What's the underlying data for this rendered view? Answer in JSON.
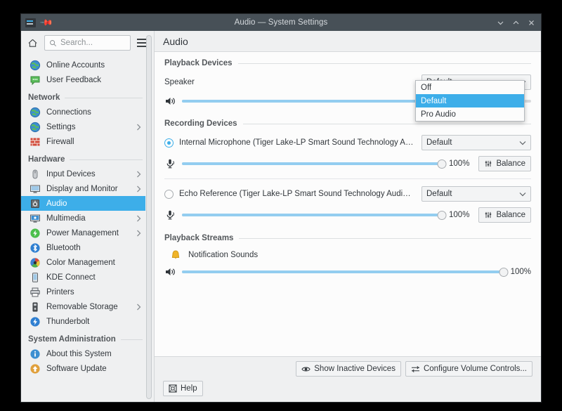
{
  "window": {
    "title": "Audio — System Settings",
    "app_icon": "system-settings-icon",
    "pin_icon": "keep-above-icon",
    "minimize_label": "Minimize",
    "maximize_label": "Maximize",
    "close_label": "Close"
  },
  "sidebar": {
    "home_icon": "home-icon",
    "menu_icon": "hamburger-menu-icon",
    "search": {
      "placeholder": "Search...",
      "value": ""
    },
    "groups": [
      {
        "title": null,
        "items": [
          {
            "label": "Online Accounts",
            "icon": "globe-icon",
            "chevron": false,
            "selected": false
          },
          {
            "label": "User Feedback",
            "icon": "feedback-icon",
            "chevron": false,
            "selected": false
          }
        ]
      },
      {
        "title": "Network",
        "items": [
          {
            "label": "Connections",
            "icon": "globe-icon",
            "chevron": false,
            "selected": false
          },
          {
            "label": "Settings",
            "icon": "globe-icon",
            "chevron": true,
            "selected": false
          },
          {
            "label": "Firewall",
            "icon": "firewall-icon",
            "chevron": false,
            "selected": false
          }
        ]
      },
      {
        "title": "Hardware",
        "items": [
          {
            "label": "Input Devices",
            "icon": "mouse-icon",
            "chevron": true,
            "selected": false
          },
          {
            "label": "Display and Monitor",
            "icon": "monitor-icon",
            "chevron": true,
            "selected": false
          },
          {
            "label": "Audio",
            "icon": "speaker-icon",
            "chevron": false,
            "selected": true
          },
          {
            "label": "Multimedia",
            "icon": "multimedia-icon",
            "chevron": true,
            "selected": false
          },
          {
            "label": "Power Management",
            "icon": "power-icon",
            "chevron": true,
            "selected": false
          },
          {
            "label": "Bluetooth",
            "icon": "bluetooth-icon",
            "chevron": false,
            "selected": false
          },
          {
            "label": "Color Management",
            "icon": "color-wheel-icon",
            "chevron": false,
            "selected": false
          },
          {
            "label": "KDE Connect",
            "icon": "phone-icon",
            "chevron": false,
            "selected": false
          },
          {
            "label": "Printers",
            "icon": "printer-icon",
            "chevron": false,
            "selected": false
          },
          {
            "label": "Removable Storage",
            "icon": "usb-drive-icon",
            "chevron": true,
            "selected": false
          },
          {
            "label": "Thunderbolt",
            "icon": "thunderbolt-icon",
            "chevron": false,
            "selected": false
          }
        ]
      },
      {
        "title": "System Administration",
        "items": [
          {
            "label": "About this System",
            "icon": "info-icon",
            "chevron": false,
            "selected": false
          },
          {
            "label": "Software Update",
            "icon": "update-icon",
            "chevron": false,
            "selected": false
          }
        ]
      }
    ]
  },
  "main": {
    "header_title": "Audio",
    "sections": {
      "playback_devices": {
        "title": "Playback Devices",
        "device": {
          "name": "Speaker",
          "port_value": "Default",
          "volume_percent": 72,
          "volume_icon": "volume-medium-icon"
        },
        "dropdown_open": true,
        "dropdown_options": [
          "Off",
          "Default",
          "Pro Audio"
        ],
        "dropdown_selected": "Default"
      },
      "recording_devices": {
        "title": "Recording Devices",
        "devices": [
          {
            "name": "Internal Microphone (Tiger Lake-LP Smart Sound Technology Audio Controlle...",
            "selected": true,
            "port_value": "Default",
            "volume_percent": 100,
            "volume_label": "100%",
            "volume_icon": "microphone-icon",
            "balance_label": "Balance",
            "balance_icon": "balance-sliders-icon"
          },
          {
            "name": "Echo Reference (Tiger Lake-LP Smart Sound Technology Audio Controller Ech...",
            "selected": false,
            "port_value": "Default",
            "volume_percent": 100,
            "volume_label": "100%",
            "volume_icon": "microphone-icon",
            "balance_label": "Balance",
            "balance_icon": "balance-sliders-icon"
          }
        ]
      },
      "playback_streams": {
        "title": "Playback Streams",
        "streams": [
          {
            "name": "Notification Sounds",
            "app_icon": "bell-icon",
            "volume_percent": 100,
            "volume_label": "100%",
            "volume_icon": "volume-medium-icon"
          }
        ]
      }
    }
  },
  "footer": {
    "show_inactive_label": "Show Inactive Devices",
    "show_inactive_icon": "eye-icon",
    "configure_label": "Configure Volume Controls...",
    "configure_icon": "sliders-icon",
    "help_label": "Help",
    "help_icon": "help-icon"
  },
  "colors": {
    "accent": "#3daee9",
    "titlebar": "#475057",
    "window_bg": "#eff0f1",
    "content_bg": "#fcfcfc",
    "slider_fill": "#93cdf0"
  }
}
